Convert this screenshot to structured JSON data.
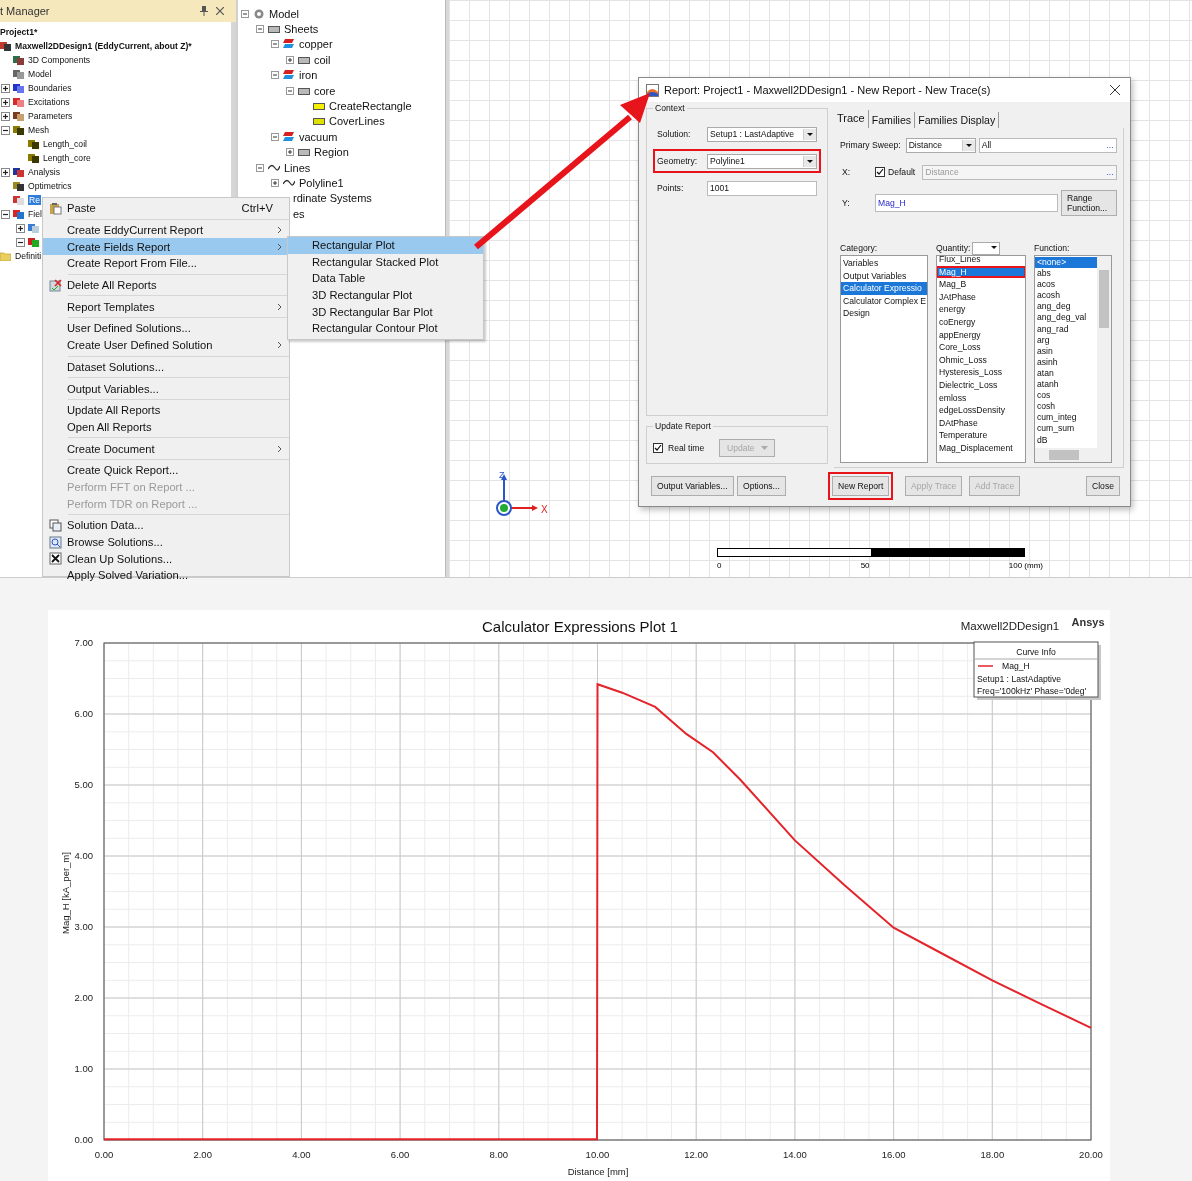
{
  "project_manager": {
    "title": "t Manager",
    "tree": [
      {
        "label": "Project1*",
        "kind": "none",
        "children": [
          {
            "label": "Maxwell2DDesign1 (EddyCurrent, about Z)*",
            "kind": "design",
            "children": [
              {
                "label": "3D Components",
                "kind": "component"
              },
              {
                "label": "Model",
                "kind": "model"
              },
              {
                "label": "Boundaries",
                "kind": "boundary",
                "expanded": false
              },
              {
                "label": "Excitations",
                "kind": "excitation",
                "expanded": false
              },
              {
                "label": "Parameters",
                "kind": "parameter",
                "expanded": false
              },
              {
                "label": "Mesh",
                "kind": "mesh",
                "expanded": true,
                "children": [
                  {
                    "label": "Length_coil",
                    "kind": "mesh"
                  },
                  {
                    "label": "Length_core",
                    "kind": "mesh"
                  }
                ]
              },
              {
                "label": "Analysis",
                "kind": "analysis",
                "expanded": false
              },
              {
                "label": "Optimetrics",
                "kind": "optimetrics"
              },
              {
                "label": "Re",
                "kind": "results",
                "selected": true
              },
              {
                "label": "Fiel",
                "kind": "fields",
                "expanded": true,
                "children": [
                  {
                    "kind": "table",
                    "expanded": false
                  },
                  {
                    "kind": "plot",
                    "expanded": true
                  }
                ]
              }
            ]
          },
          {
            "label": "Definiti",
            "kind": "folder"
          }
        ]
      }
    ]
  },
  "model_tree": [
    {
      "label": "Model",
      "kind": "model",
      "expanded": true,
      "children": [
        {
          "label": "Sheets",
          "kind": "sheet",
          "expanded": true,
          "children": [
            {
              "label": "copper",
              "kind": "material",
              "expanded": true,
              "children": [
                {
                  "label": "coil",
                  "kind": "sheet",
                  "expanded": false
                }
              ]
            },
            {
              "label": "iron",
              "kind": "material",
              "expanded": true,
              "children": [
                {
                  "label": "core",
                  "kind": "sheet",
                  "expanded": true,
                  "children": [
                    {
                      "label": "CreateRectangle",
                      "kind": "rect"
                    },
                    {
                      "label": "CoverLines",
                      "kind": "cover"
                    }
                  ]
                }
              ]
            },
            {
              "label": "vacuum",
              "kind": "material",
              "expanded": true,
              "children": [
                {
                  "label": "Region",
                  "kind": "sheet",
                  "expanded": false
                }
              ]
            }
          ]
        },
        {
          "label": "Lines",
          "kind": "line",
          "expanded": true,
          "children": [
            {
              "label": "Polyline1",
              "kind": "line",
              "expanded": false
            }
          ]
        }
      ]
    },
    {
      "label": "rdinate Systems",
      "kind": "partial"
    },
    {
      "label": "es",
      "kind": "partial"
    }
  ],
  "context_menu": [
    [
      {
        "label": "Paste",
        "kind": "paste",
        "shortcut": "Ctrl+V",
        "submenu": false,
        "disabled": false,
        "selected": false
      }
    ],
    [
      {
        "label": "Create EddyCurrent Report",
        "kind": "text",
        "submenu": true,
        "disabled": false,
        "selected": false
      },
      {
        "label": "Create Fields Report",
        "kind": "text",
        "submenu": true,
        "disabled": false,
        "selected": true
      },
      {
        "label": "Create Report From File...",
        "kind": "text",
        "submenu": false,
        "disabled": false,
        "selected": false
      }
    ],
    [
      {
        "label": "Delete All Reports",
        "kind": "delete",
        "submenu": false,
        "disabled": false,
        "selected": false
      }
    ],
    [
      {
        "label": "Report Templates",
        "kind": "text",
        "submenu": true,
        "disabled": false,
        "selected": false
      }
    ],
    [
      {
        "label": "User Defined Solutions...",
        "kind": "text",
        "submenu": false,
        "disabled": false,
        "selected": false
      },
      {
        "label": "Create User Defined Solution",
        "kind": "text",
        "submenu": true,
        "disabled": false,
        "selected": false
      }
    ],
    [
      {
        "label": "Dataset Solutions...",
        "kind": "text",
        "submenu": false,
        "disabled": false,
        "selected": false
      }
    ],
    [
      {
        "label": "Output Variables...",
        "kind": "text",
        "submenu": false,
        "disabled": false,
        "selected": false
      }
    ],
    [
      {
        "label": "Update All Reports",
        "kind": "text",
        "submenu": false,
        "disabled": false,
        "selected": false
      },
      {
        "label": "Open All Reports",
        "kind": "text",
        "submenu": false,
        "disabled": false,
        "selected": false
      }
    ],
    [
      {
        "label": "Create Document",
        "kind": "text",
        "submenu": true,
        "disabled": false,
        "selected": false
      }
    ],
    [
      {
        "label": "Create Quick Report...",
        "kind": "text",
        "submenu": false,
        "disabled": false,
        "selected": false
      },
      {
        "label": "Perform FFT on Report ...",
        "kind": "text",
        "submenu": false,
        "disabled": true,
        "selected": false
      },
      {
        "label": "Perform TDR on Report ...",
        "kind": "text",
        "submenu": false,
        "disabled": true,
        "selected": false
      }
    ],
    [
      {
        "label": "Solution Data...",
        "kind": "data",
        "submenu": false,
        "disabled": false,
        "selected": false
      },
      {
        "label": "Browse Solutions...",
        "kind": "browse",
        "submenu": false,
        "disabled": false,
        "selected": false
      },
      {
        "label": "Clean Up Solutions...",
        "kind": "cleanup",
        "submenu": false,
        "disabled": false,
        "selected": false
      },
      {
        "label": "Apply Solved Variation...",
        "kind": "text",
        "submenu": false,
        "disabled": false,
        "selected": false
      }
    ]
  ],
  "submenu": [
    {
      "label": "Rectangular Plot",
      "selected": true
    },
    {
      "label": "Rectangular Stacked Plot",
      "selected": false
    },
    {
      "label": "Data Table",
      "selected": false
    },
    {
      "label": "3D Rectangular Plot",
      "selected": false
    },
    {
      "label": "3D Rectangular Bar Plot",
      "selected": false
    },
    {
      "label": "Rectangular Contour Plot",
      "selected": false
    }
  ],
  "canvas": {
    "triad": {
      "z": "Z",
      "x": "X"
    },
    "scale_labels": [
      "0",
      "50",
      "100 (mm)"
    ]
  },
  "dialog": {
    "title": "Report: Project1 - Maxwell2DDesign1 - New Report - New Trace(s)",
    "context": {
      "legend": "Context",
      "fields": [
        {
          "label": "Solution:",
          "kind": "dropdown",
          "value": "Setup1 : LastAdaptive",
          "highlighted": false
        },
        {
          "label": "Geometry:",
          "kind": "dropdown",
          "value": "Polyline1",
          "highlighted": true
        },
        {
          "label": "Points:",
          "kind": "text",
          "value": "1001",
          "highlighted": false
        }
      ]
    },
    "update_report": {
      "legend": "Update Report",
      "real_time": {
        "label": "Real time",
        "checked": true
      },
      "update_button": {
        "label": "Update",
        "disabled": true
      }
    },
    "tabs": [
      {
        "label": "Trace",
        "selected": true
      },
      {
        "label": "Families",
        "selected": false
      },
      {
        "label": "Families Display",
        "selected": false
      }
    ],
    "primary_sweep": {
      "label": "Primary Sweep:",
      "value": "Distance",
      "range": "All",
      "more": "..."
    },
    "x": {
      "label": "X:",
      "default": {
        "label": "Default",
        "checked": true
      },
      "value": "Distance",
      "disabled": true,
      "more": "..."
    },
    "y": {
      "label": "Y:",
      "value": "Mag_H",
      "range_button": "Range Function..."
    },
    "category": {
      "label": "Category:",
      "items": [
        {
          "label": "Variables",
          "selected": false
        },
        {
          "label": "Output Variables",
          "selected": false
        },
        {
          "label": "Calculator Expressio",
          "selected": true
        },
        {
          "label": "Calculator Complex E",
          "selected": false
        },
        {
          "label": "Design",
          "selected": false
        }
      ]
    },
    "quantity": {
      "label": "Quantity:",
      "items": [
        {
          "label": "Flux_Lines",
          "selected": false,
          "highlighted": false
        },
        {
          "label": "Mag_H",
          "selected": true,
          "highlighted": true
        },
        {
          "label": "Mag_B",
          "selected": false,
          "highlighted": false
        },
        {
          "label": "JAtPhase",
          "selected": false,
          "highlighted": false
        },
        {
          "label": "energy",
          "selected": false,
          "highlighted": false
        },
        {
          "label": "coEnergy",
          "selected": false,
          "highlighted": false
        },
        {
          "label": "appEnergy",
          "selected": false,
          "highlighted": false
        },
        {
          "label": "Core_Loss",
          "selected": false,
          "highlighted": false
        },
        {
          "label": "Ohmic_Loss",
          "selected": false,
          "highlighted": false
        },
        {
          "label": "Hysteresis_Loss",
          "selected": false,
          "highlighted": false
        },
        {
          "label": "Dielectric_Loss",
          "selected": false,
          "highlighted": false
        },
        {
          "label": "emloss",
          "selected": false,
          "highlighted": false
        },
        {
          "label": "edgeLossDensity",
          "selected": false,
          "highlighted": false
        },
        {
          "label": "DAtPhase",
          "selected": false,
          "highlighted": false
        },
        {
          "label": "Temperature",
          "selected": false,
          "highlighted": false
        },
        {
          "label": "Mag_Displacement",
          "selected": false,
          "highlighted": false
        }
      ]
    },
    "function": {
      "label": "Function:",
      "items": [
        {
          "label": "<none>",
          "selected": true
        },
        {
          "label": "abs",
          "selected": false
        },
        {
          "label": "acos",
          "selected": false
        },
        {
          "label": "acosh",
          "selected": false
        },
        {
          "label": "ang_deg",
          "selected": false
        },
        {
          "label": "ang_deg_val",
          "selected": false
        },
        {
          "label": "ang_rad",
          "selected": false
        },
        {
          "label": "arg",
          "selected": false
        },
        {
          "label": "asin",
          "selected": false
        },
        {
          "label": "asinh",
          "selected": false
        },
        {
          "label": "atan",
          "selected": false
        },
        {
          "label": "atanh",
          "selected": false
        },
        {
          "label": "cos",
          "selected": false
        },
        {
          "label": "cosh",
          "selected": false
        },
        {
          "label": "cum_integ",
          "selected": false
        },
        {
          "label": "cum_sum",
          "selected": false
        },
        {
          "label": "dB",
          "selected": false
        }
      ]
    },
    "buttons": [
      {
        "label": "Output Variables...",
        "disabled": false,
        "highlighted": false
      },
      {
        "label": "Options...",
        "disabled": false,
        "highlighted": false
      },
      {
        "label": "New Report",
        "disabled": false,
        "highlighted": true
      },
      {
        "label": "Apply Trace",
        "disabled": true,
        "highlighted": false
      },
      {
        "label": "Add Trace",
        "disabled": true,
        "highlighted": false
      },
      {
        "label": "Close",
        "disabled": false,
        "highlighted": false
      }
    ]
  },
  "chart": {
    "title": "Calculator Expressions Plot 1",
    "design": "Maxwell2DDesign1",
    "brand": "Ansys",
    "legend": {
      "title": "Curve Info",
      "lines": [
        "Setup1 : LastAdaptive",
        "Freq='100kHz' Phase='0deg'"
      ]
    },
    "chart_data": {
      "type": "line",
      "xlabel": "Distance [mm]",
      "ylabel": "Mag_H [kA_per_m]",
      "x": [
        0,
        2,
        4,
        6,
        8,
        9.99,
        10,
        10.5,
        11.17,
        11.8,
        12.34,
        12.9,
        14,
        15,
        16,
        17,
        18,
        19,
        20
      ],
      "series": [
        {
          "name": "Mag_H",
          "color": "#e3242b",
          "values": [
            0.01,
            0.01,
            0.01,
            0.01,
            0.01,
            0.01,
            6.42,
            6.3,
            6.1,
            5.72,
            5.46,
            5.07,
            4.22,
            3.59,
            2.99,
            2.62,
            2.25,
            1.91,
            1.58
          ]
        }
      ],
      "xlim": [
        0,
        20
      ],
      "ylim": [
        0,
        7
      ],
      "grid": true,
      "xticks": [
        {
          "value": 0,
          "label": "0.00"
        },
        {
          "value": 2,
          "label": "2.00"
        },
        {
          "value": 4,
          "label": "4.00"
        },
        {
          "value": 6,
          "label": "6.00"
        },
        {
          "value": 8,
          "label": "8.00"
        },
        {
          "value": 10,
          "label": "10.00"
        },
        {
          "value": 12,
          "label": "12.00"
        },
        {
          "value": 14,
          "label": "14.00"
        },
        {
          "value": 16,
          "label": "16.00"
        },
        {
          "value": 18,
          "label": "18.00"
        },
        {
          "value": 20,
          "label": "20.00"
        }
      ],
      "yticks": [
        {
          "value": 0,
          "label": "0.00"
        },
        {
          "value": 1,
          "label": "1.00"
        },
        {
          "value": 2,
          "label": "2.00"
        },
        {
          "value": 3,
          "label": "3.00"
        },
        {
          "value": 4,
          "label": "4.00"
        },
        {
          "value": 5,
          "label": "5.00"
        },
        {
          "value": 6,
          "label": "6.00"
        },
        {
          "value": 7,
          "label": "7.00"
        }
      ]
    }
  }
}
